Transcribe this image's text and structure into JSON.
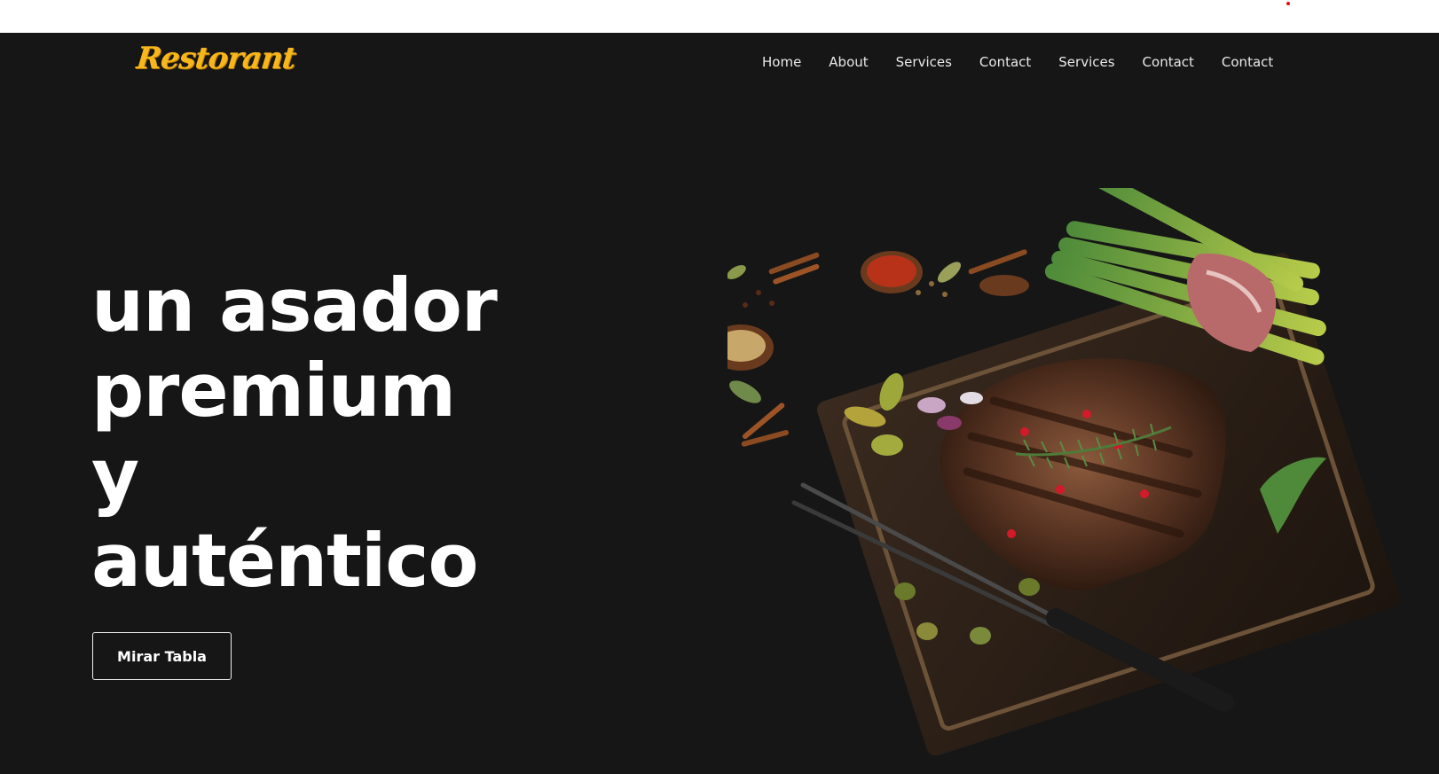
{
  "brand": {
    "logo_text": "Restorant",
    "logo_color": "#f7b61b"
  },
  "nav": {
    "items": [
      {
        "label": "Home"
      },
      {
        "label": "About"
      },
      {
        "label": "Services"
      },
      {
        "label": "Contact"
      },
      {
        "label": "Services"
      },
      {
        "label": "Contact"
      },
      {
        "label": "Contact"
      }
    ]
  },
  "hero": {
    "lines": [
      "un asador",
      "premium",
      "y",
      "auténtico"
    ],
    "cta_label": "Mirar Tabla",
    "image_icon": "steak-board-illustration"
  },
  "colors": {
    "background": "#161616",
    "text": "#ffffff",
    "accent": "#f7b61b"
  }
}
